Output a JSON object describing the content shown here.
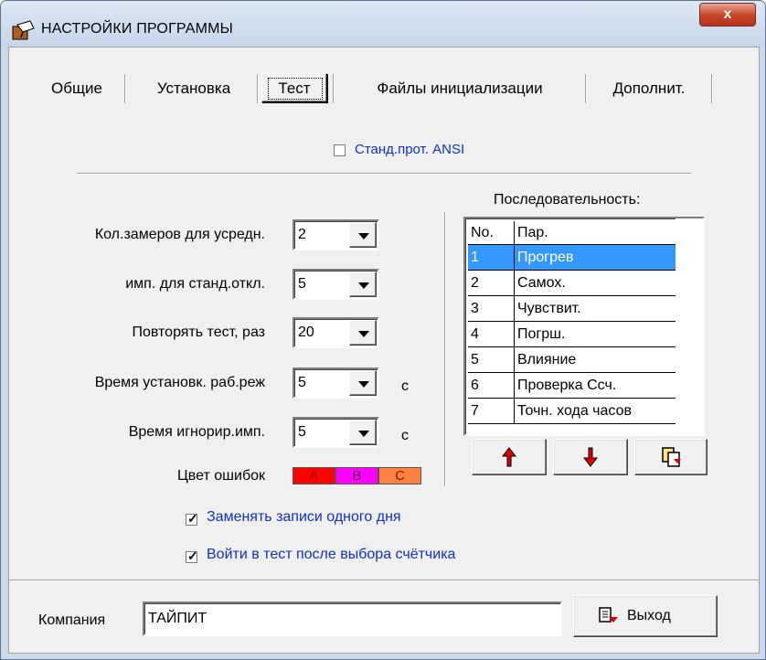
{
  "window": {
    "title": "НАСТРОЙКИ ПРОГРАММЫ",
    "close_glyph": "x"
  },
  "tabs": [
    {
      "label": "Общие"
    },
    {
      "label": "Установка"
    },
    {
      "label": "Тест",
      "active": true
    },
    {
      "label": "Файлы инициализации"
    },
    {
      "label": "Дополнит."
    }
  ],
  "ansi": {
    "label": "Станд.прот. ANSI",
    "checked": false
  },
  "settings": [
    {
      "label": "Кол.замеров для усредн.",
      "value": "2",
      "unit": ""
    },
    {
      "label": "имп. для станд.откл.",
      "value": "5",
      "unit": ""
    },
    {
      "label": "Повторять тест, раз",
      "value": "20",
      "unit": ""
    },
    {
      "label": "Время установк. раб.реж",
      "value": "5",
      "unit": "с"
    },
    {
      "label": "Время игнорир.имп.",
      "value": "5",
      "unit": "с"
    }
  ],
  "error_colors": {
    "label": "Цвет ошибок",
    "boxes": [
      {
        "letter": "A",
        "color": "#ff0000"
      },
      {
        "letter": "B",
        "color": "#ff00ff"
      },
      {
        "letter": "C",
        "color": "#ff8040"
      }
    ]
  },
  "sequence": {
    "title": "Последовательность:",
    "headers": [
      "No.",
      "Пар."
    ],
    "rows": [
      {
        "no": "1",
        "name": "Прогрев",
        "selected": true
      },
      {
        "no": "2",
        "name": "Самох."
      },
      {
        "no": "3",
        "name": "Чувствит."
      },
      {
        "no": "4",
        "name": "Погрш."
      },
      {
        "no": "5",
        "name": "Влияние"
      },
      {
        "no": "6",
        "name": "Проверка Ссч."
      },
      {
        "no": "7",
        "name": "Точн. хода часов"
      }
    ],
    "buttons": [
      "arrow-up-icon",
      "arrow-down-icon",
      "copy-doc-icon"
    ]
  },
  "options": [
    {
      "label": "Заменять записи одного дня",
      "checked": true
    },
    {
      "label": "Войти в тест после выбора счётчика",
      "checked": true
    }
  ],
  "company": {
    "label": "Компания",
    "value": "ТАЙПИТ"
  },
  "exit_button": {
    "label": "Выход"
  },
  "colors": {
    "accent_blue": "#1030c8",
    "selection": "#3399ff"
  }
}
